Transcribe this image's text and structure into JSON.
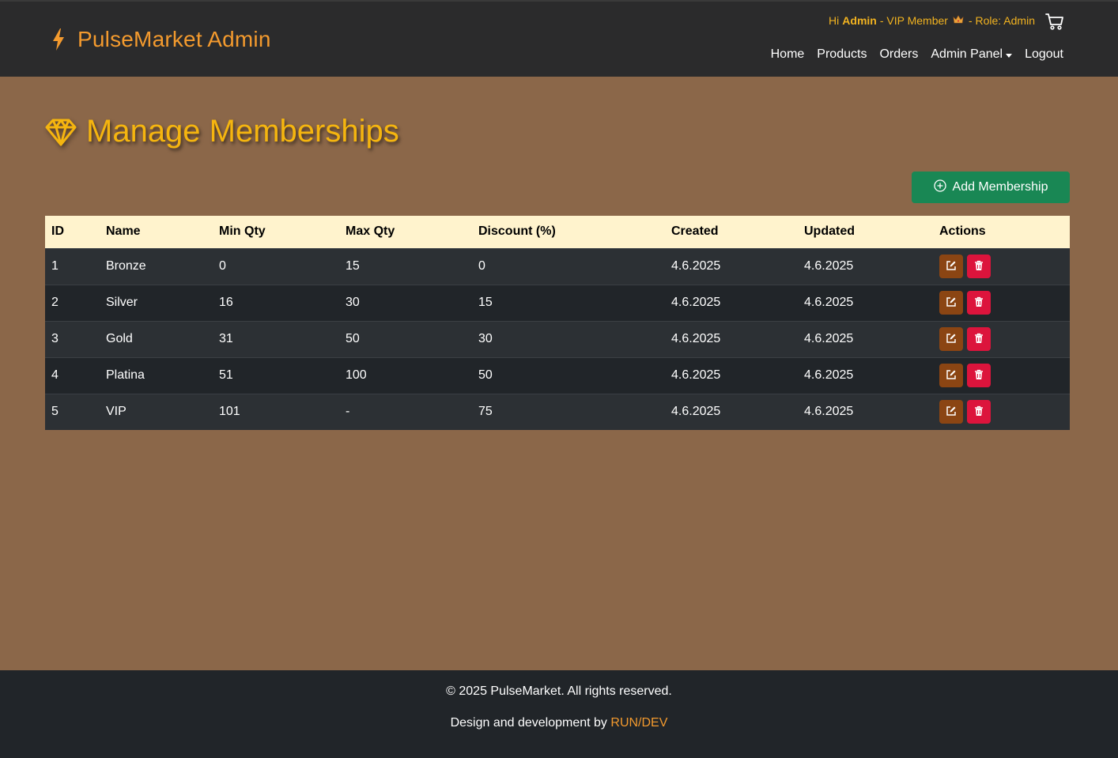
{
  "brand": {
    "name": "PulseMarket Admin"
  },
  "header": {
    "greeting": "Hi",
    "username": "Admin",
    "membership": "- VIP Member",
    "role": "- Role: Admin",
    "nav": [
      "Home",
      "Products",
      "Orders",
      "Admin Panel",
      "Logout"
    ]
  },
  "page": {
    "title": "Manage Memberships",
    "add_button": "Add Membership"
  },
  "table": {
    "columns": [
      "ID",
      "Name",
      "Min Qty",
      "Max Qty",
      "Discount (%)",
      "Created",
      "Updated",
      "Actions"
    ],
    "rows": [
      [
        "1",
        "Bronze",
        "0",
        "15",
        "0",
        "4.6.2025",
        "4.6.2025"
      ],
      [
        "2",
        "Silver",
        "16",
        "30",
        "15",
        "4.6.2025",
        "4.6.2025"
      ],
      [
        "3",
        "Gold",
        "31",
        "50",
        "30",
        "4.6.2025",
        "4.6.2025"
      ],
      [
        "4",
        "Platina",
        "51",
        "100",
        "50",
        "4.6.2025",
        "4.6.2025"
      ],
      [
        "5",
        "VIP",
        "101",
        "-",
        "75",
        "4.6.2025",
        "4.6.2025"
      ]
    ]
  },
  "footer": {
    "copyright": "© 2025 PulseMarket. All rights reserved.",
    "credit_prefix": "Design and development by",
    "credit_link": "RUN/DEV"
  },
  "colors": {
    "brand": "#f39a2e",
    "title": "#f5b50f",
    "page_bg": "#8b6749",
    "navbar_bg": "#2b2b2c",
    "add_button": "#198754",
    "edit_button": "#8b4513",
    "delete_button": "#dc143c",
    "table_header_bg": "#fff3cd"
  },
  "icons": {
    "brand": "lightning-icon",
    "crown": "crown-icon",
    "cart": "cart-icon",
    "title": "gem-icon",
    "add": "plus-circle-icon",
    "edit": "edit-icon",
    "delete": "trash-icon"
  }
}
